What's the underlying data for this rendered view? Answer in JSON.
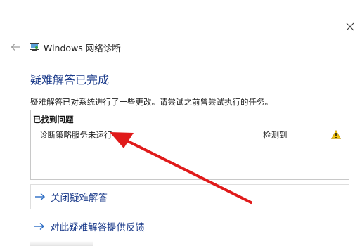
{
  "window": {
    "app_title": "Windows 网络诊断",
    "icons": {
      "close": "close-icon",
      "back": "back-arrow-icon",
      "app": "network-diagnostics-icon"
    }
  },
  "main": {
    "heading": "疑难解答已完成",
    "description": "疑难解答已对系统进行了一些更改。请尝试之前曾尝试执行的任务。"
  },
  "problems": {
    "header": "已找到问题",
    "items": [
      {
        "name": "诊断策略服务未运行",
        "status": "检测到",
        "icon": "warning-icon"
      }
    ]
  },
  "actions": [
    {
      "label": "关闭疑难解答",
      "icon": "arrow-right-icon"
    },
    {
      "label": "对此疑难解答提供反馈",
      "icon": "arrow-right-icon"
    }
  ],
  "colors": {
    "accent": "#1a3a8a",
    "link_arrow": "#2b6cc4",
    "warning": "#f2c40f",
    "annotation": "#e01a1a"
  }
}
